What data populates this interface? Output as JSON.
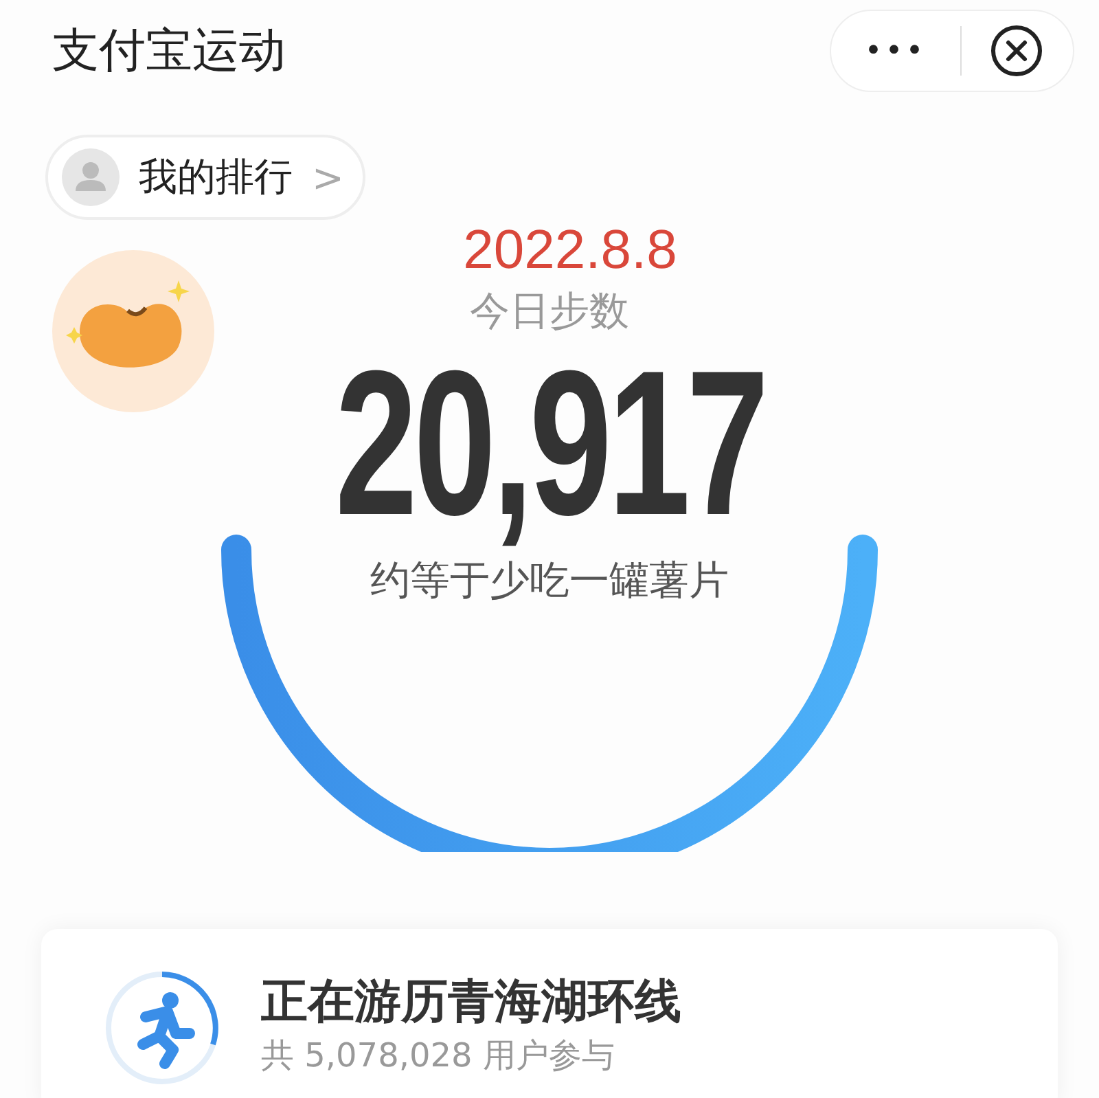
{
  "window": {
    "title": "支付宝运动"
  },
  "capsule": {
    "more": "•••"
  },
  "ranking": {
    "label": "我的排行",
    "arrow": ">"
  },
  "steps": {
    "date": "2022.8.8",
    "label": "今日步数",
    "count": "20,917",
    "equivalent": "约等于少吃一罐薯片"
  },
  "route": {
    "title": "正在游历青海湖环线",
    "participants": "共 5,078,028 用户参与"
  }
}
